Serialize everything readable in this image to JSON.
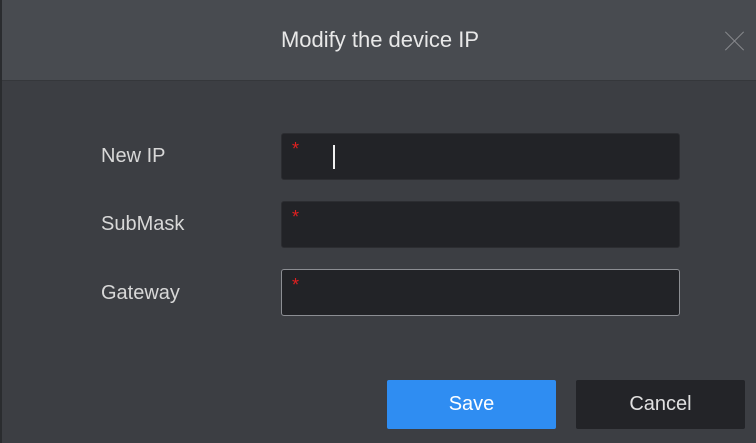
{
  "dialog": {
    "title": "Modify the device IP",
    "close_icon": "close-icon"
  },
  "form": {
    "fields": [
      {
        "label": "New IP",
        "value": "",
        "required_mark": "*"
      },
      {
        "label": "SubMask",
        "value": "",
        "required_mark": "*"
      },
      {
        "label": "Gateway",
        "value": "",
        "required_mark": "*"
      }
    ]
  },
  "buttons": {
    "save_label": "Save",
    "cancel_label": "Cancel"
  },
  "colors": {
    "accent": "#2f8df2",
    "required": "#e02020",
    "background": "#3c3e43",
    "titlebar": "#484b50"
  }
}
